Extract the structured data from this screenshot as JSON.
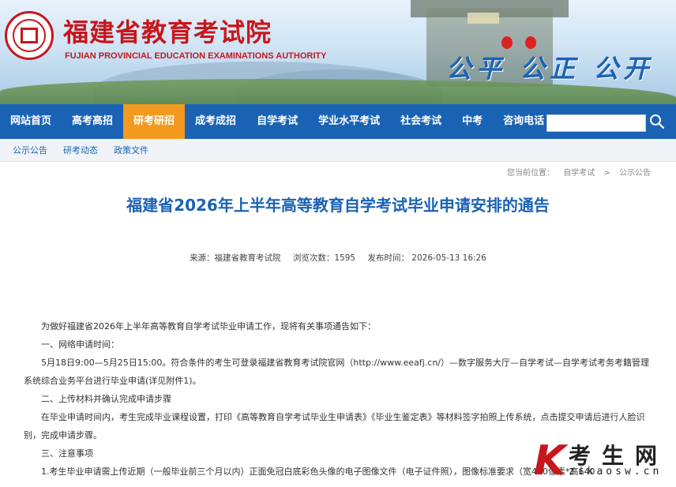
{
  "header": {
    "title": "福建省教育考试院",
    "subtitle": "FUJIAN PROVINCIAL EDUCATION EXAMINATIONS AUTHORITY",
    "slogan": "公平 公正 公开",
    "logo_icon": "seal-logo-icon",
    "brand_color": "#c8161d"
  },
  "nav": {
    "items": [
      {
        "label": "网站首页"
      },
      {
        "label": "高考高招"
      },
      {
        "label": "研考研招"
      },
      {
        "label": "成考成招"
      },
      {
        "label": "自学考试"
      },
      {
        "label": "学业水平考试"
      },
      {
        "label": "社会考试"
      },
      {
        "label": "中考"
      },
      {
        "label": "咨询电话"
      }
    ],
    "active_index": 2,
    "nav_color": "#1a63b4",
    "active_color": "#f39a1e",
    "search_value": "",
    "search_icon": "search-icon"
  },
  "subnav": {
    "items": [
      {
        "label": "公示公告"
      },
      {
        "label": "研考动态"
      },
      {
        "label": "政策文件"
      }
    ]
  },
  "breadcrumb": {
    "prefix": "您当前位置：",
    "items": [
      "自学考试",
      "公示公告"
    ],
    "separator": ">"
  },
  "article": {
    "title": "福建省2026年上半年高等教育自学考试毕业申请安排的通告",
    "source": "来源：福建省教育考试院",
    "views": "浏览次数：1595",
    "published": "发布时间： 2026-05-13 16:26",
    "paragraphs": [
      "为做好福建省2026年上半年高等教育自学考试毕业申请工作，现将有关事项通告如下：",
      "一、网络申请时间：",
      "5月18日9:00—5月25日15:00。符合条件的考生可登录福建省教育考试院官网（http://www.eeafj.cn/）—数字服务大厅—自学考试—自学考试考务考籍管理系统综合业务平台进行毕业申请(详见附件1)。",
      "二、上传材料并确认完成申请步骤",
      "在毕业申请时间内，考生完成毕业课程设置，打印《高等教育自学考试毕业生申请表》《毕业生鉴定表》等材料签字拍照上传系统，点击提交申请后进行人脸识别，完成申请步骤。",
      "三、注意事项",
      "1.考生毕业申请需上传近期（一般毕业前三个月以内）正面免冠白底彩色头像的电子图像文件（电子证件照），图像标准要求（宽480像素*高640"
    ]
  },
  "watermark": {
    "letter": "K",
    "name": "考生网",
    "url": "zikaosw.cn"
  }
}
